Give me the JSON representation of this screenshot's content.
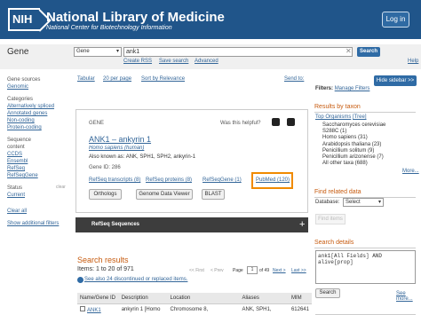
{
  "header": {
    "logo": "NIH",
    "title": "National Library of Medicine",
    "subtitle": "National Center for Biotechnology Information",
    "login": "Log in"
  },
  "search": {
    "db_label": "Gene",
    "db_selected": "Gene",
    "query": "ank1",
    "button": "Search",
    "links": [
      "Create RSS",
      "Save search",
      "Advanced"
    ],
    "help": "Help"
  },
  "left": {
    "groups": [
      {
        "title": "Gene sources",
        "items": [
          "Genomic"
        ]
      },
      {
        "title": "Categories",
        "items": [
          "Alternatively spliced",
          "Annotated genes",
          "Non-coding",
          "Protein-coding"
        ]
      },
      {
        "title": "Sequence content",
        "items": [
          "CCDS",
          "Ensembl",
          "RefSeq",
          "RefSeqGene"
        ]
      },
      {
        "title": "Status",
        "items": [
          "Current"
        ]
      }
    ],
    "clear": "clear",
    "clear_all": "Clear all",
    "show_filters": "Show additional filters"
  },
  "toolbar": {
    "format": "Tabular",
    "per_page": "20 per page",
    "sort": "Sort by Relevance",
    "send_to": "Send to:",
    "filters_label": "Filters:",
    "manage": "Manage Filters",
    "hide_sidebar": "Hide sidebar >>"
  },
  "gene": {
    "label": "GENE",
    "helpful": "Was this helpful?",
    "title": "ANK1 – ankyrin 1",
    "organism": "Homo sapiens (human)",
    "aliases": "Also known as: ANK, SPH1, SPH2, ankyrin-1",
    "gene_id": "Gene ID: 286",
    "links": [
      "RefSeq transcripts (8)",
      "RefSeq proteins (8)",
      "RefSeqGene (1)",
      "PubMed (120)"
    ],
    "buttons": [
      "Orthologs",
      "Genome Data Viewer",
      "BLAST"
    ],
    "refseq": "RefSeq Sequences"
  },
  "results": {
    "title": "Search results",
    "items": "Items: 1 to 20 of 971",
    "pager": {
      "first": "<< First",
      "prev": "< Prev",
      "page_label": "Page",
      "page": "1",
      "of": "of 49",
      "next": "Next >",
      "last": "Last >>"
    },
    "also": "See also 24 discontinued or replaced items.",
    "columns": [
      "Name/Gene ID",
      "Description",
      "Location",
      "Aliases",
      "MIM"
    ],
    "rows": [
      [
        "ANK1",
        "ankyrin 1 [Homo",
        "Chromosome 8,",
        "ANK, SPH1,",
        "612641"
      ]
    ]
  },
  "sidebar": {
    "taxon_title": "Results by taxon",
    "top_org": "Top Organisms",
    "tree": "[Tree]",
    "orgs": [
      "Saccharomyces cerevisiae S288C (1)",
      "Homo sapiens (31)",
      "Arabidopsis thaliana (23)",
      "Penicillium solitum (9)",
      "Penicillium arizonense (7)",
      "All other taxa (688)"
    ],
    "more": "More...",
    "find_title": "Find related data",
    "db_label": "Database:",
    "db_select": "Select",
    "find_btn": "Find items",
    "details_title": "Search details",
    "details_query": "ank1[All Fields] AND alive[prop]",
    "details_btn": "Search",
    "see_more": "See more..."
  },
  "colors": {
    "header_bg": "#20558a",
    "accent": "#c75b0f",
    "link": "#336699",
    "highlight": "#f08a00"
  }
}
